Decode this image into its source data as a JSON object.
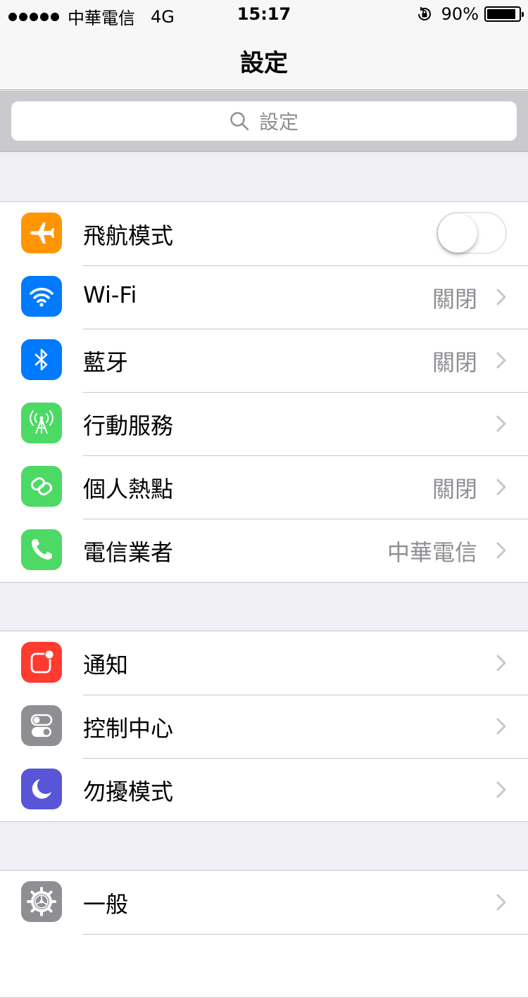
{
  "status": {
    "carrier": "中華電信",
    "network": "4G",
    "time": "15:17",
    "battery_text": "90%",
    "battery_level": 0.9
  },
  "nav": {
    "title": "設定"
  },
  "search": {
    "placeholder": "設定"
  },
  "colors": {
    "orange": "#ff9500",
    "blue": "#007aff",
    "green": "#4cd964",
    "red": "#ff3b30",
    "gray": "#8e8e93",
    "purple": "#5856d6"
  },
  "group1": [
    {
      "label": "飛航模式",
      "icon": "airplane-icon",
      "toggle": false
    },
    {
      "label": "Wi-Fi",
      "icon": "wifi-icon",
      "value": "關閉"
    },
    {
      "label": "藍牙",
      "icon": "bluetooth-icon",
      "value": "關閉"
    },
    {
      "label": "行動服務",
      "icon": "cellular-icon"
    },
    {
      "label": "個人熱點",
      "icon": "hotspot-icon",
      "value": "關閉"
    },
    {
      "label": "電信業者",
      "icon": "phone-icon",
      "value": "中華電信"
    }
  ],
  "group2": [
    {
      "label": "通知",
      "icon": "notifications-icon"
    },
    {
      "label": "控制中心",
      "icon": "control-center-icon"
    },
    {
      "label": "勿擾模式",
      "icon": "moon-icon"
    }
  ],
  "group3": [
    {
      "label": "一般",
      "icon": "gear-icon"
    }
  ]
}
